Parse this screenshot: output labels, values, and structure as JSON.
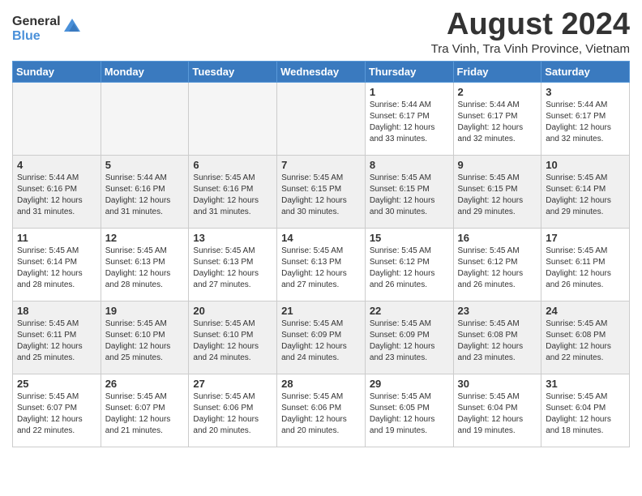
{
  "header": {
    "logo_general": "General",
    "logo_blue": "Blue",
    "month_year": "August 2024",
    "location": "Tra Vinh, Tra Vinh Province, Vietnam"
  },
  "weekdays": [
    "Sunday",
    "Monday",
    "Tuesday",
    "Wednesday",
    "Thursday",
    "Friday",
    "Saturday"
  ],
  "weeks": [
    [
      {
        "day": "",
        "info": ""
      },
      {
        "day": "",
        "info": ""
      },
      {
        "day": "",
        "info": ""
      },
      {
        "day": "",
        "info": ""
      },
      {
        "day": "1",
        "info": "Sunrise: 5:44 AM\nSunset: 6:17 PM\nDaylight: 12 hours\nand 33 minutes."
      },
      {
        "day": "2",
        "info": "Sunrise: 5:44 AM\nSunset: 6:17 PM\nDaylight: 12 hours\nand 32 minutes."
      },
      {
        "day": "3",
        "info": "Sunrise: 5:44 AM\nSunset: 6:17 PM\nDaylight: 12 hours\nand 32 minutes."
      }
    ],
    [
      {
        "day": "4",
        "info": "Sunrise: 5:44 AM\nSunset: 6:16 PM\nDaylight: 12 hours\nand 31 minutes."
      },
      {
        "day": "5",
        "info": "Sunrise: 5:44 AM\nSunset: 6:16 PM\nDaylight: 12 hours\nand 31 minutes."
      },
      {
        "day": "6",
        "info": "Sunrise: 5:45 AM\nSunset: 6:16 PM\nDaylight: 12 hours\nand 31 minutes."
      },
      {
        "day": "7",
        "info": "Sunrise: 5:45 AM\nSunset: 6:15 PM\nDaylight: 12 hours\nand 30 minutes."
      },
      {
        "day": "8",
        "info": "Sunrise: 5:45 AM\nSunset: 6:15 PM\nDaylight: 12 hours\nand 30 minutes."
      },
      {
        "day": "9",
        "info": "Sunrise: 5:45 AM\nSunset: 6:15 PM\nDaylight: 12 hours\nand 29 minutes."
      },
      {
        "day": "10",
        "info": "Sunrise: 5:45 AM\nSunset: 6:14 PM\nDaylight: 12 hours\nand 29 minutes."
      }
    ],
    [
      {
        "day": "11",
        "info": "Sunrise: 5:45 AM\nSunset: 6:14 PM\nDaylight: 12 hours\nand 28 minutes."
      },
      {
        "day": "12",
        "info": "Sunrise: 5:45 AM\nSunset: 6:13 PM\nDaylight: 12 hours\nand 28 minutes."
      },
      {
        "day": "13",
        "info": "Sunrise: 5:45 AM\nSunset: 6:13 PM\nDaylight: 12 hours\nand 27 minutes."
      },
      {
        "day": "14",
        "info": "Sunrise: 5:45 AM\nSunset: 6:13 PM\nDaylight: 12 hours\nand 27 minutes."
      },
      {
        "day": "15",
        "info": "Sunrise: 5:45 AM\nSunset: 6:12 PM\nDaylight: 12 hours\nand 26 minutes."
      },
      {
        "day": "16",
        "info": "Sunrise: 5:45 AM\nSunset: 6:12 PM\nDaylight: 12 hours\nand 26 minutes."
      },
      {
        "day": "17",
        "info": "Sunrise: 5:45 AM\nSunset: 6:11 PM\nDaylight: 12 hours\nand 26 minutes."
      }
    ],
    [
      {
        "day": "18",
        "info": "Sunrise: 5:45 AM\nSunset: 6:11 PM\nDaylight: 12 hours\nand 25 minutes."
      },
      {
        "day": "19",
        "info": "Sunrise: 5:45 AM\nSunset: 6:10 PM\nDaylight: 12 hours\nand 25 minutes."
      },
      {
        "day": "20",
        "info": "Sunrise: 5:45 AM\nSunset: 6:10 PM\nDaylight: 12 hours\nand 24 minutes."
      },
      {
        "day": "21",
        "info": "Sunrise: 5:45 AM\nSunset: 6:09 PM\nDaylight: 12 hours\nand 24 minutes."
      },
      {
        "day": "22",
        "info": "Sunrise: 5:45 AM\nSunset: 6:09 PM\nDaylight: 12 hours\nand 23 minutes."
      },
      {
        "day": "23",
        "info": "Sunrise: 5:45 AM\nSunset: 6:08 PM\nDaylight: 12 hours\nand 23 minutes."
      },
      {
        "day": "24",
        "info": "Sunrise: 5:45 AM\nSunset: 6:08 PM\nDaylight: 12 hours\nand 22 minutes."
      }
    ],
    [
      {
        "day": "25",
        "info": "Sunrise: 5:45 AM\nSunset: 6:07 PM\nDaylight: 12 hours\nand 22 minutes."
      },
      {
        "day": "26",
        "info": "Sunrise: 5:45 AM\nSunset: 6:07 PM\nDaylight: 12 hours\nand 21 minutes."
      },
      {
        "day": "27",
        "info": "Sunrise: 5:45 AM\nSunset: 6:06 PM\nDaylight: 12 hours\nand 20 minutes."
      },
      {
        "day": "28",
        "info": "Sunrise: 5:45 AM\nSunset: 6:06 PM\nDaylight: 12 hours\nand 20 minutes."
      },
      {
        "day": "29",
        "info": "Sunrise: 5:45 AM\nSunset: 6:05 PM\nDaylight: 12 hours\nand 19 minutes."
      },
      {
        "day": "30",
        "info": "Sunrise: 5:45 AM\nSunset: 6:04 PM\nDaylight: 12 hours\nand 19 minutes."
      },
      {
        "day": "31",
        "info": "Sunrise: 5:45 AM\nSunset: 6:04 PM\nDaylight: 12 hours\nand 18 minutes."
      }
    ]
  ]
}
